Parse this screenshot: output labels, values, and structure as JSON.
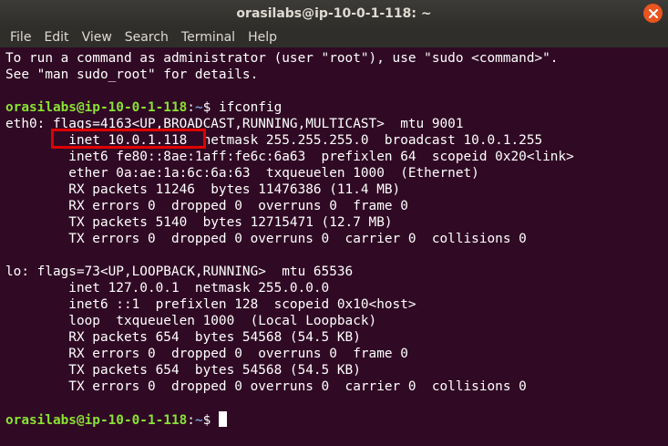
{
  "window": {
    "title": "orasilabs@ip-10-0-1-118: ~"
  },
  "menu": [
    "File",
    "Edit",
    "View",
    "Search",
    "Terminal",
    "Help"
  ],
  "terminal": {
    "prompt_user": "orasilabs@ip-10-0-1-118",
    "prompt_path": "~",
    "lines": [
      {
        "type": "text",
        "text": "To run a command as administrator (user \"root\"), use \"sudo <command>\"."
      },
      {
        "type": "text",
        "text": "See \"man sudo_root\" for details."
      },
      {
        "type": "text",
        "text": ""
      },
      {
        "type": "prompt",
        "command": " ifconfig"
      },
      {
        "type": "text",
        "text": "eth0: flags=4163<UP,BROADCAST,RUNNING,MULTICAST>  mtu 9001"
      },
      {
        "type": "text",
        "text": "        inet 10.0.1.118  netmask 255.255.255.0  broadcast 10.0.1.255"
      },
      {
        "type": "text",
        "text": "        inet6 fe80::8ae:1aff:fe6c:6a63  prefixlen 64  scopeid 0x20<link>"
      },
      {
        "type": "text",
        "text": "        ether 0a:ae:1a:6c:6a:63  txqueuelen 1000  (Ethernet)"
      },
      {
        "type": "text",
        "text": "        RX packets 11246  bytes 11476386 (11.4 MB)"
      },
      {
        "type": "text",
        "text": "        RX errors 0  dropped 0  overruns 0  frame 0"
      },
      {
        "type": "text",
        "text": "        TX packets 5140  bytes 12715471 (12.7 MB)"
      },
      {
        "type": "text",
        "text": "        TX errors 0  dropped 0 overruns 0  carrier 0  collisions 0"
      },
      {
        "type": "text",
        "text": ""
      },
      {
        "type": "text",
        "text": "lo: flags=73<UP,LOOPBACK,RUNNING>  mtu 65536"
      },
      {
        "type": "text",
        "text": "        inet 127.0.0.1  netmask 255.0.0.0"
      },
      {
        "type": "text",
        "text": "        inet6 ::1  prefixlen 128  scopeid 0x10<host>"
      },
      {
        "type": "text",
        "text": "        loop  txqueuelen 1000  (Local Loopback)"
      },
      {
        "type": "text",
        "text": "        RX packets 654  bytes 54568 (54.5 KB)"
      },
      {
        "type": "text",
        "text": "        RX errors 0  dropped 0  overruns 0  frame 0"
      },
      {
        "type": "text",
        "text": "        TX packets 654  bytes 54568 (54.5 KB)"
      },
      {
        "type": "text",
        "text": "        TX errors 0  dropped 0 overruns 0  carrier 0  collisions 0"
      },
      {
        "type": "text",
        "text": ""
      },
      {
        "type": "prompt",
        "command": " "
      }
    ]
  },
  "colors": {
    "background": "#300a24",
    "prompt_user": "#8ae234",
    "prompt_path": "#729fcf",
    "highlight": "#e00000",
    "close_button": "#e95420"
  }
}
